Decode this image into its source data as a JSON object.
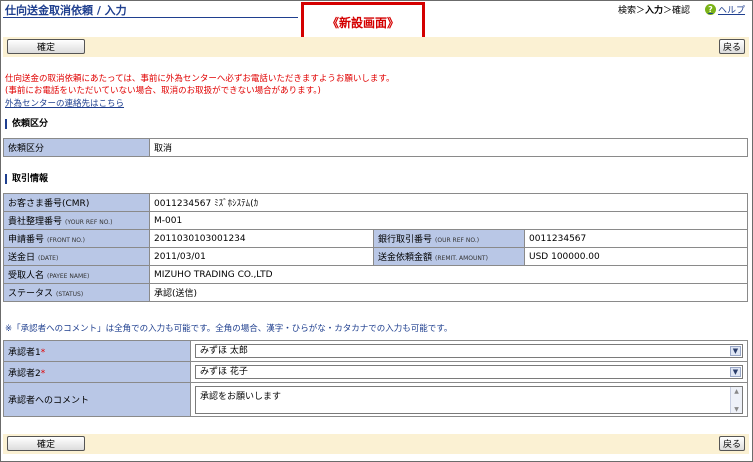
{
  "header": {
    "title": "仕向送金取消依頼 / 入力",
    "new_screen_label": "《新設画面》",
    "steps_prefix": "検索＞",
    "steps_current": "入力",
    "steps_suffix": "＞確認",
    "help_label": "ヘルプ",
    "help_icon": "?"
  },
  "buttons": {
    "confirm": "確定",
    "back": "戻る"
  },
  "notice": {
    "line1": "仕向送金の取消依頼にあたっては、事前に外為センターへ必ずお電話いただきますようお願いします。",
    "line2": "(事前にお電話をいただいていない場合、取消のお取扱ができない場合があります。)",
    "link": "外為センターの連絡先はこちら"
  },
  "request_section": {
    "heading": "依頼区分",
    "label": "依頼区分",
    "value": "取消"
  },
  "trade_section": {
    "heading": "取引情報",
    "customer_no": {
      "label": "お客さま番号(CMR)",
      "value": "0011234567 ﾐｽﾞﾎｼｽﾃﾑ(ｶ"
    },
    "your_ref": {
      "label": "貴社整理番号",
      "en": "(YOUR REF NO.)",
      "value": "M-001"
    },
    "front_no": {
      "label": "申請番号",
      "en": "(FRONT NO.)",
      "value": "2011030103001234"
    },
    "our_ref": {
      "label": "銀行取引番号",
      "en": "(OUR REF NO.)",
      "value": "0011234567"
    },
    "date": {
      "label": "送金日",
      "en": "(DATE)",
      "value": "2011/03/01"
    },
    "amount": {
      "label": "送金依頼金額",
      "en": "(REMIT. AMOUNT)",
      "value": "USD 100000.00"
    },
    "payee": {
      "label": "受取人名",
      "en": "(PAYEE NAME)",
      "value": "MIZUHO TRADING CO.,LTD"
    },
    "status": {
      "label": "ステータス",
      "en": "(STATUS)",
      "value": "承認(送信)"
    }
  },
  "comment_note": "※「承認者へのコメント」は全角での入力も可能です。全角の場合、漢字・ひらがな・カタカナでの入力も可能です。",
  "approvers": {
    "approver1_label": "承認者1",
    "approver1_value": "みずほ 太郎",
    "approver2_label": "承認者2",
    "approver2_value": "みずほ 花子",
    "required_mark": "*",
    "comment_label": "承認者へのコメント",
    "comment_value": "承認をお願いします"
  },
  "colors": {
    "title_blue": "#1f3f8f",
    "label_bg": "#b9c7e6",
    "button_bar_bg": "#fbf1d3",
    "notice_red": "#e00000",
    "new_screen_red": "#d40000"
  }
}
